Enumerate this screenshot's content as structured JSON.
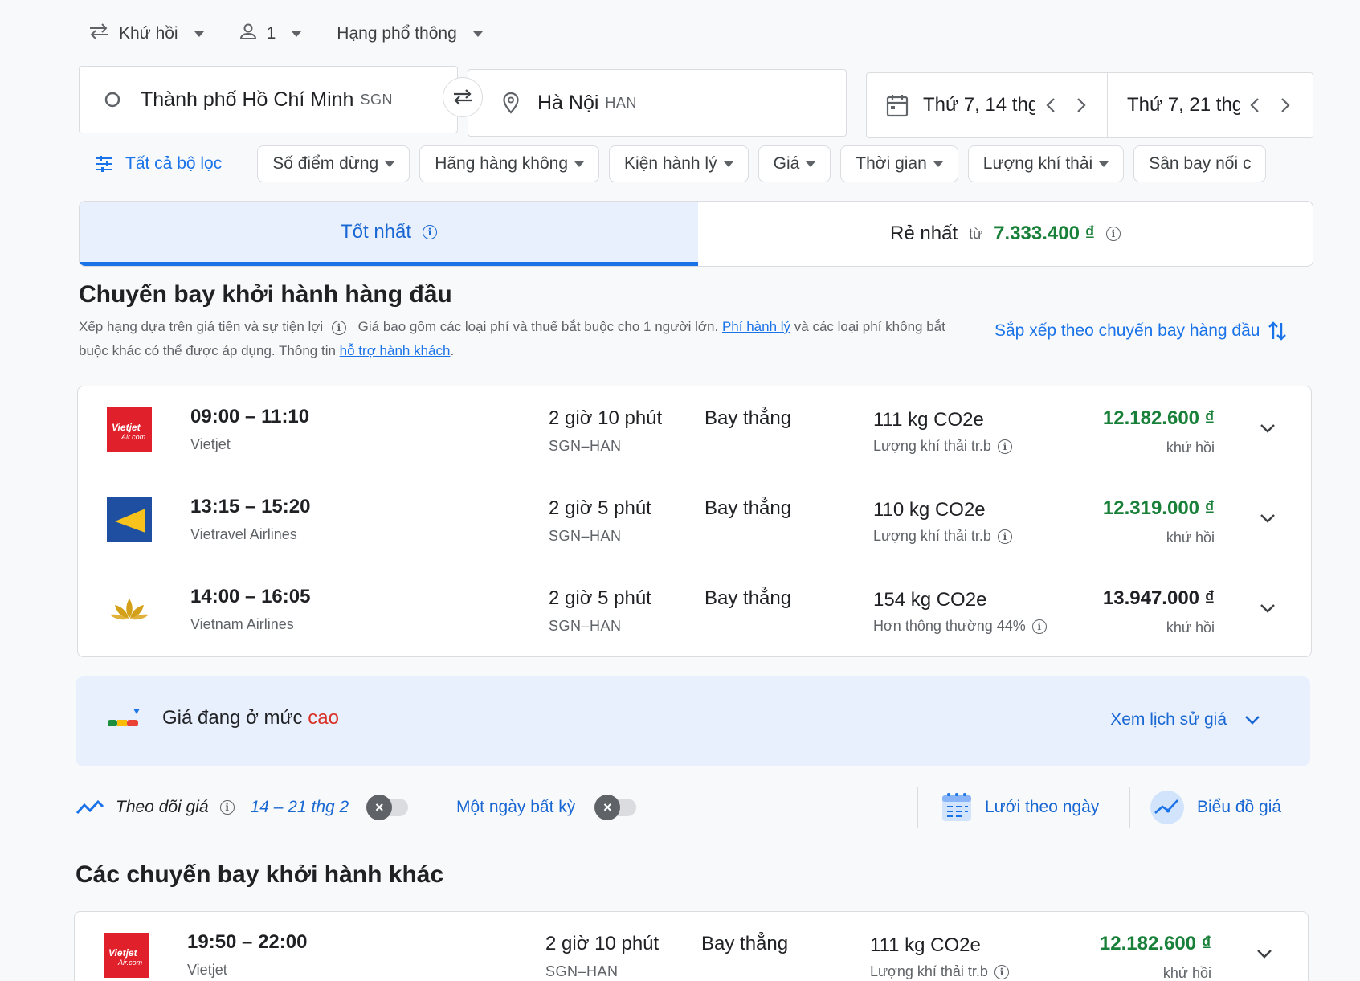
{
  "search": {
    "trip_type": "Khứ hồi",
    "passengers": "1",
    "cabin_class": "Hạng phổ thông",
    "origin_city": "Thành phố Hồ Chí Minh",
    "origin_code": "SGN",
    "destination_city": "Hà Nội",
    "destination_code": "HAN",
    "depart_date": "Thứ 7, 14 thg",
    "return_date": "Thứ 7, 21 thg"
  },
  "filters": {
    "all_filters_label": "Tất cả bộ lọc",
    "chips": [
      "Số điểm dừng",
      "Hãng hàng không",
      "Kiện hành lý",
      "Giá",
      "Thời gian",
      "Lượng khí thải",
      "Sân bay nối c"
    ]
  },
  "tabs": {
    "best_label": "Tốt nhất",
    "cheapest_label": "Rẻ nhất",
    "cheapest_from": "từ",
    "cheapest_price": "7.333.400 ₫"
  },
  "top_section": {
    "title": "Chuyến bay khởi hành hàng đầu",
    "ranking_note": "Xếp hạng dựa trên giá tiền và sự tiện lợi",
    "fee_note_1": "Giá bao gồm các loại phí và thuế bắt buộc cho 1 người lớn.",
    "baggage_fee_link": "Phí hành lý",
    "fee_note_2": "và các loại phí không bắt buộc khác có thể được áp dụng. Thông tin",
    "passenger_help_link": "hỗ trợ hành khách",
    "fee_note_end": ".",
    "sort_label": "Sắp xếp theo chuyến bay hàng đầu"
  },
  "flights": [
    {
      "times": "09:00 – 11:10",
      "airline": "Vietjet",
      "logo": "vietjet-logo",
      "duration": "2 giờ 10 phút",
      "route": "SGN–HAN",
      "stops": "Bay thẳng",
      "co2": "111 kg CO2e",
      "co2_note": "Lượng khí thải tr.b",
      "price": "12.182.600 ₫",
      "price_color": "#188038",
      "trip": "khứ hồi"
    },
    {
      "times": "13:15 – 15:20",
      "airline": "Vietravel Airlines",
      "logo": "vietravel-logo",
      "duration": "2 giờ 5 phút",
      "route": "SGN–HAN",
      "stops": "Bay thẳng",
      "co2": "110 kg CO2e",
      "co2_note": "Lượng khí thải tr.b",
      "price": "12.319.000 ₫",
      "price_color": "#188038",
      "trip": "khứ hồi"
    },
    {
      "times": "14:00 – 16:05",
      "airline": "Vietnam Airlines",
      "logo": "vietnam-airlines-logo",
      "duration": "2 giờ 5 phút",
      "route": "SGN–HAN",
      "stops": "Bay thẳng",
      "co2": "154 kg CO2e",
      "co2_note": "Hơn thông thường 44%",
      "price": "13.947.000 ₫",
      "price_color": "#202124",
      "trip": "khứ hồi"
    }
  ],
  "insight": {
    "prefix": "Giá đang ở mức",
    "level": "cao",
    "history_link": "Xem lịch sử giá"
  },
  "tracking": {
    "track_label": "Theo dõi giá",
    "track_dates": "14 – 21 thg 2",
    "any_date_label": "Một ngày bất kỳ",
    "date_grid_label": "Lưới theo ngày",
    "price_graph_label": "Biểu đồ giá"
  },
  "other_section": {
    "title": "Các chuyến bay khởi hành khác",
    "flights": [
      {
        "times": "19:50 – 22:00",
        "airline": "Vietjet",
        "logo": "vietjet-logo",
        "duration": "2 giờ 10 phút",
        "route": "SGN–HAN",
        "stops": "Bay thẳng",
        "co2": "111 kg CO2e",
        "co2_note": "Lượng khí thải tr.b",
        "price": "12.182.600 ₫",
        "price_color": "#188038",
        "trip": "khứ hồi"
      }
    ]
  },
  "colors": {
    "accent_blue": "#1a73e8",
    "price_green": "#188038",
    "high_price_red": "#d93025",
    "vietjet_red": "#e0202a",
    "vietravel_blue": "#1f4fa0",
    "vietnam_airlines_gold": "#d4a019"
  }
}
